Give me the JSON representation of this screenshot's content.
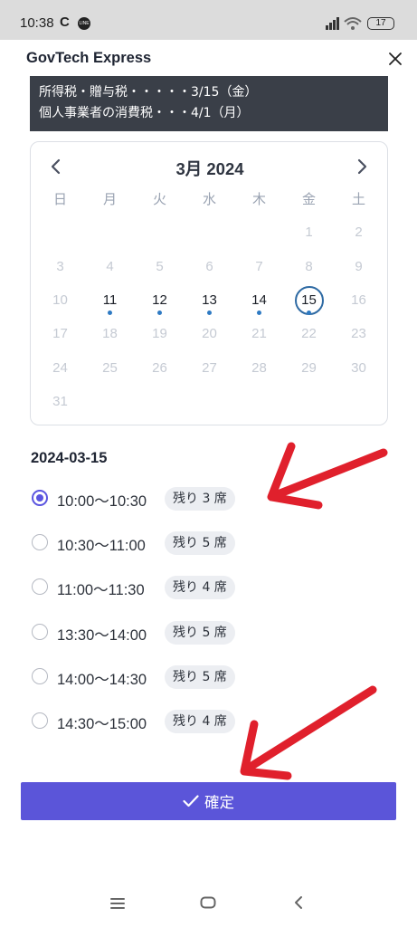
{
  "status_bar": {
    "time": "10:38",
    "c_icon": "C",
    "line_badge": "LINE",
    "battery": "17"
  },
  "header": {
    "title": "GovTech Express",
    "close_icon": "close-icon"
  },
  "notice": {
    "lines": [
      "所得税・贈与税・・・・・3/15（金）",
      "個人事業者の消費税・・・4/1（月）"
    ]
  },
  "calendar": {
    "title": "3月 2024",
    "weekdays": [
      "日",
      "月",
      "火",
      "水",
      "木",
      "金",
      "土"
    ],
    "leading_blanks": 5,
    "days_in_month": 31,
    "available_days": [
      11,
      12,
      13,
      14,
      15
    ],
    "selected_day": 15
  },
  "selected_date": "2024-03-15",
  "slots": [
    {
      "time": "10:00〜10:30",
      "remaining": "残り 3 席",
      "selected": true
    },
    {
      "time": "10:30〜11:00",
      "remaining": "残り 5 席",
      "selected": false
    },
    {
      "time": "11:00〜11:30",
      "remaining": "残り 4 席",
      "selected": false
    },
    {
      "time": "13:30〜14:00",
      "remaining": "残り 5 席",
      "selected": false
    },
    {
      "time": "14:00〜14:30",
      "remaining": "残り 5 席",
      "selected": false
    },
    {
      "time": "14:30〜15:00",
      "remaining": "残り 4 席",
      "selected": false
    }
  ],
  "confirm": {
    "label": "確定"
  },
  "colors": {
    "accent": "#5b55d9",
    "arrow": "#e0202c",
    "selected_ring": "#2e6aa3",
    "notice_bg": "#3a3f48"
  }
}
